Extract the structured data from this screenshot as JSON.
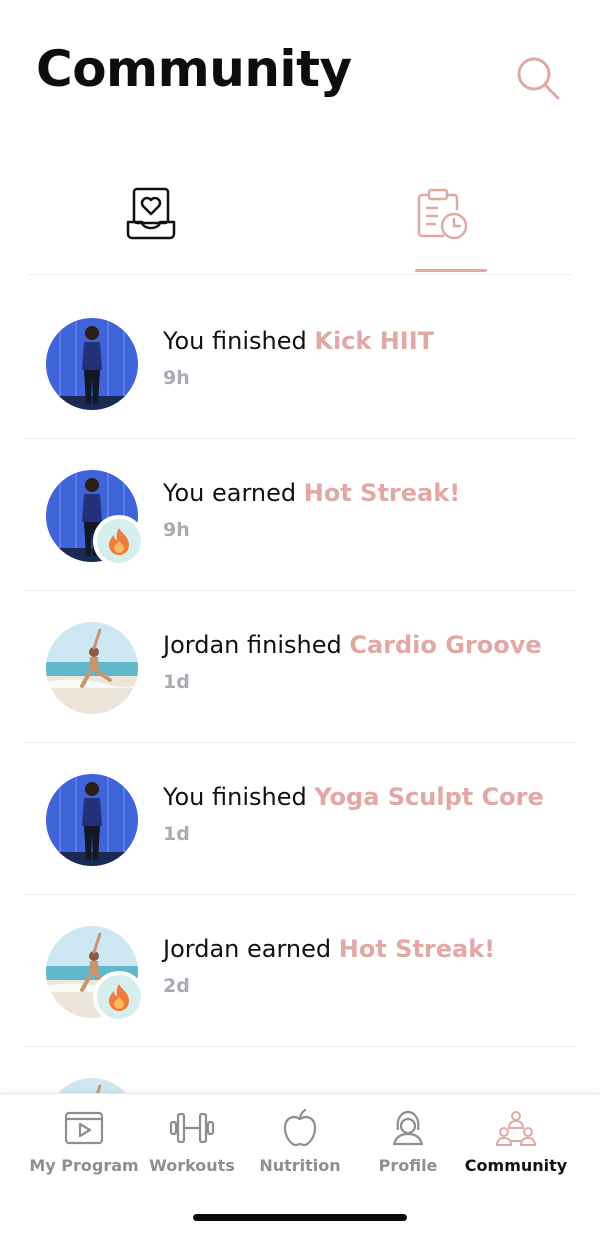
{
  "header": {
    "title": "Community"
  },
  "tabs": [
    {
      "name": "likes-tab",
      "icon": "heart-inbox-icon",
      "active": false
    },
    {
      "name": "activity-tab",
      "icon": "clipboard-clock-icon",
      "active": true
    }
  ],
  "feed": [
    {
      "prefix": "You finished ",
      "highlight": "Kick HIIT",
      "time": "9h",
      "avatar": "user-avatar",
      "badge": null
    },
    {
      "prefix": "You earned ",
      "highlight": "Hot Streak!",
      "time": "9h",
      "avatar": "user-avatar",
      "badge": "fire-icon"
    },
    {
      "prefix": "Jordan finished ",
      "highlight": "Cardio Groove",
      "time": "1d",
      "avatar": "jordan-avatar",
      "badge": null
    },
    {
      "prefix": "You finished ",
      "highlight": "Yoga Sculpt Core",
      "time": "1d",
      "avatar": "user-avatar",
      "badge": null
    },
    {
      "prefix": "Jordan earned ",
      "highlight": "Hot Streak!",
      "time": "2d",
      "avatar": "jordan-avatar",
      "badge": "fire-icon"
    }
  ],
  "tabbar": [
    {
      "label": "My Program",
      "icon": "play-window-icon",
      "active": false
    },
    {
      "label": "Workouts",
      "icon": "dumbbell-icon",
      "active": false
    },
    {
      "label": "Nutrition",
      "icon": "apple-icon",
      "active": false
    },
    {
      "label": "Profile",
      "icon": "profile-icon",
      "active": false
    },
    {
      "label": "Community",
      "icon": "community-icon",
      "active": true
    }
  ],
  "colors": {
    "accent": "#e2a9a4",
    "muted": "#a9acb4",
    "badge_bg": "#d6efec"
  }
}
